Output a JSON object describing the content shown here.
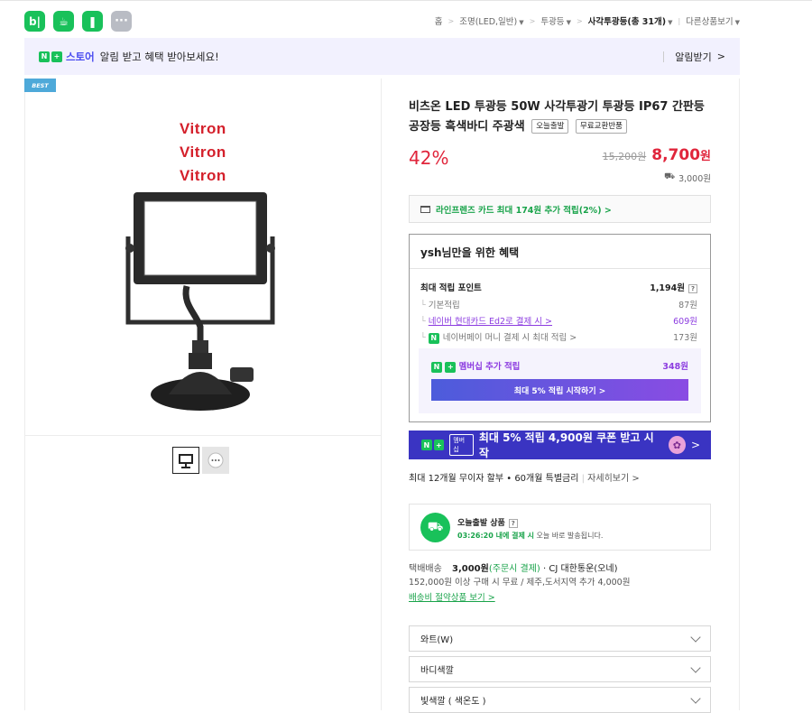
{
  "top": {
    "app_icons": [
      {
        "name": "blog-icon",
        "glyph": "b|"
      },
      {
        "name": "cafe-icon",
        "glyph": "☕"
      },
      {
        "name": "bookmark-icon",
        "glyph": "❚"
      },
      {
        "name": "more-icon",
        "glyph": "···"
      }
    ],
    "breadcrumb": {
      "home": "홈",
      "cat1": "조명(LED,일반)",
      "cat2": "투광등",
      "cat3": "사각투광등(총 31개)",
      "other": "다른상품보기"
    }
  },
  "notice": {
    "n_badge": "N",
    "plus_badge": "+",
    "store": "스토어",
    "message": "알림 받고 혜택 받아보세요!",
    "action": "알림받기"
  },
  "gallery": {
    "best_label": "BEST",
    "brand_lines": [
      "Vitron",
      "Vitron",
      "Vitron"
    ]
  },
  "product": {
    "title": "비츠온 LED 투광등 50W 사각투광기 투광등 IP67 간판등 공장등 흑색바디 주광색",
    "tags": [
      "오늘출발",
      "무료교환반품"
    ],
    "discount": "42%",
    "original_price": "15,200원",
    "sale_price": "8,700",
    "sale_unit": "원",
    "shipping_fee": "3,000원"
  },
  "card_benefit": "라인프렌즈 카드 최대 174원 추가 적립(2%) >",
  "benefit": {
    "header": "ysh님만을 위한 혜택",
    "max_label": "최대 적립 포인트",
    "max_value": "1,194원",
    "rows": [
      {
        "label": "기본적립",
        "value": "87원"
      },
      {
        "label": "네이버 현대카드 Ed2로 결제 시 >",
        "value": "609원"
      },
      {
        "label": "네이버페이 머니 결제 시 최대 적립 >",
        "value": "173원"
      }
    ],
    "member_label": "멤버십 추가 적립",
    "member_value": "348원",
    "member_button": "최대 5% 적립 시작하기 >"
  },
  "coupon": {
    "badge": "멤버십",
    "text": "최대 5% 적립 4,900원 쿠폰 받고 시작",
    "arrow": ">"
  },
  "installment": {
    "text": "최대 12개월 무이자 할부 • 60개월 특별금리",
    "more": "자세히보기 >"
  },
  "today": {
    "title": "오늘출발 상품",
    "time": "03:26:20 내에 결제 시",
    "desc": "오늘 바로 발송됩니다."
  },
  "shipping": {
    "label": "택배배송",
    "fee": "3,000원",
    "fee_note": "(주문시 결제)",
    "carrier": "· CJ 대한통운(오네)",
    "condition": "152,000원 이상 구매 시 무료 / 제주,도서지역 추가 4,000원",
    "link": "배송비 절약상품 보기 >"
  },
  "options": [
    "와트(W)",
    "바디색깔",
    "빛색깔 ( 색온도 )"
  ],
  "colors": {
    "naver_green": "#19c15a",
    "price_red": "#e0253b",
    "purple": "#8c3ce0",
    "coupon_blue": "#3a34c2"
  }
}
